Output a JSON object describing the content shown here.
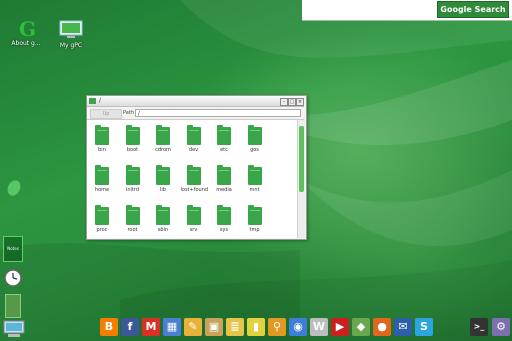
{
  "search": {
    "placeholder": "",
    "button_label": "Google Search"
  },
  "desktop_icons": [
    {
      "label": "About g...",
      "icon": "gos-logo-icon"
    },
    {
      "label": "My gPC",
      "icon": "monitor-icon"
    }
  ],
  "window": {
    "title": "/",
    "up_button": "Up",
    "location_label": "Path",
    "location_value": "/",
    "folders": [
      "bin",
      "boot",
      "cdrom",
      "dev",
      "etc",
      "gos",
      "home",
      "initrd",
      "lib",
      "lost+found",
      "media",
      "mnt",
      "proc",
      "root",
      "sbin",
      "srv",
      "sys",
      "tmp"
    ]
  },
  "side_widgets": {
    "notes_label": "Notes"
  },
  "dock": [
    {
      "name": "blogger",
      "glyph": "B",
      "color": "#f57d00"
    },
    {
      "name": "facebook",
      "glyph": "f",
      "color": "#3b5998"
    },
    {
      "name": "gmail",
      "glyph": "M",
      "color": "#d93025"
    },
    {
      "name": "calendar",
      "glyph": "▦",
      "color": "#4a7fd4"
    },
    {
      "name": "paint",
      "glyph": "✎",
      "color": "#e8b23a"
    },
    {
      "name": "photos",
      "glyph": "▣",
      "color": "#c9a35a"
    },
    {
      "name": "documents",
      "glyph": "≣",
      "color": "#e6c44a"
    },
    {
      "name": "shopping",
      "glyph": "▮",
      "color": "#e3d23d"
    },
    {
      "name": "maps",
      "glyph": "⚲",
      "color": "#e09a22"
    },
    {
      "name": "chrome",
      "glyph": "◉",
      "color": "#3d7fd6"
    },
    {
      "name": "wikipedia",
      "glyph": "W",
      "color": "#bdbdbd"
    },
    {
      "name": "youtube",
      "glyph": "▶",
      "color": "#cc1f1f"
    },
    {
      "name": "games",
      "glyph": "◆",
      "color": "#6aa84f"
    },
    {
      "name": "firefox",
      "glyph": "●",
      "color": "#e0661d"
    },
    {
      "name": "thunderbird",
      "glyph": "✉",
      "color": "#2d5fa8"
    },
    {
      "name": "skype",
      "glyph": "S",
      "color": "#2aa5e0"
    },
    {
      "name": "terminal",
      "glyph": ">_",
      "color": "#333333"
    },
    {
      "name": "settings",
      "glyph": "⚙",
      "color": "#7b6fb0"
    }
  ],
  "colors": {
    "accent": "#2f8a3a",
    "folder": "#3aa64a"
  }
}
